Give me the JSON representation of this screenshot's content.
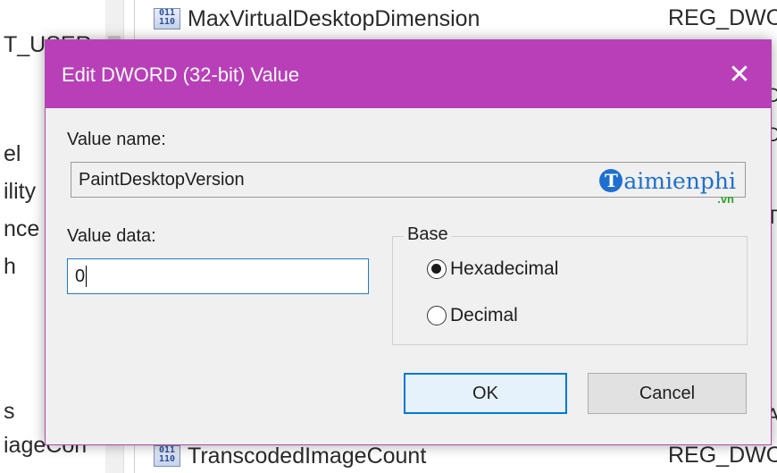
{
  "background": {
    "tree_items": [
      "T_USER",
      "el",
      "ility",
      "nce",
      "h",
      "s",
      "iageCon"
    ],
    "list_rows": [
      {
        "icon": "reg-dword-icon",
        "name": "MaxVirtualDesktopDimension",
        "type": "REG_DWO"
      },
      {
        "icon": "reg-dword-icon",
        "name": "TranscodedImageCount",
        "type": "REG_DWO"
      }
    ],
    "right_strip": [
      "D",
      "D",
      "T",
      "A"
    ]
  },
  "dialog": {
    "title": "Edit DWORD (32-bit) Value",
    "close_icon": "close-icon",
    "value_name_label": "Value name:",
    "value_name": "PaintDesktopVersion",
    "value_data_label": "Value data:",
    "value_data": "0",
    "base_label": "Base",
    "base_options": [
      {
        "label": "Hexadecimal",
        "selected": true
      },
      {
        "label": "Decimal",
        "selected": false
      }
    ],
    "ok_label": "OK",
    "cancel_label": "Cancel",
    "accent_color": "#b93fb9"
  },
  "watermark": {
    "icon_letter": "T",
    "text": "aimienphi",
    "suffix": ".vn"
  }
}
